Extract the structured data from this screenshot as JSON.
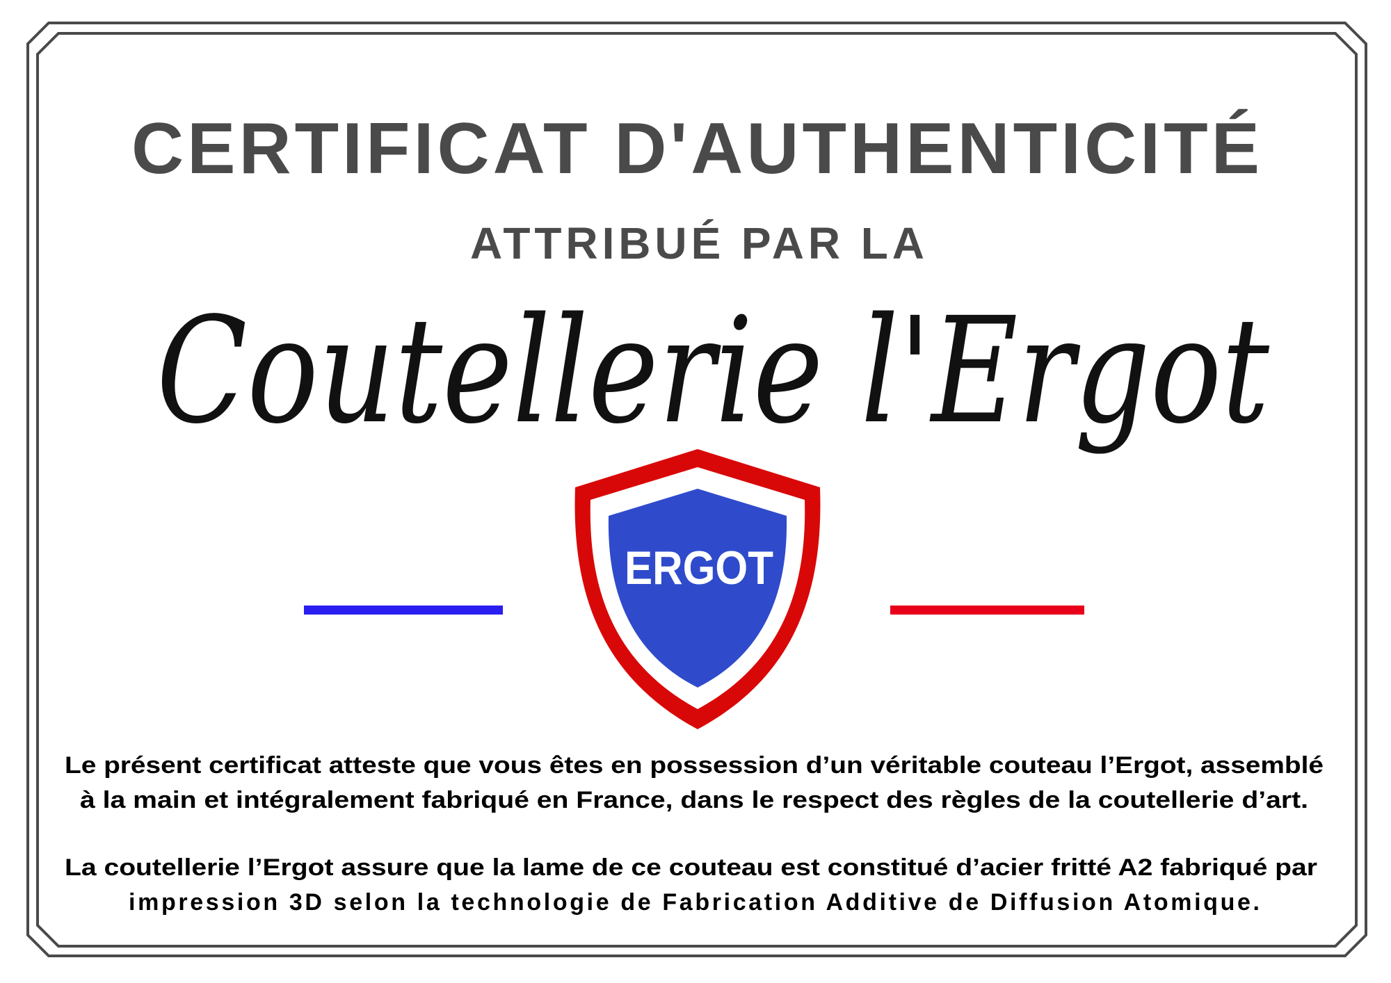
{
  "certificate": {
    "title": "CERTIFICAT D'AUTHENTICITÉ",
    "subtitle": "ATTRIBUÉ PAR LA",
    "brand_script": "Coutellerie l'Ergot",
    "shield_label": "ERGOT",
    "colors": {
      "blue": "#2f4bcc",
      "red": "#d90808",
      "line_blue": "#2a1ef0",
      "line_red": "#e8001a",
      "text_gray": "#4a4a4a"
    },
    "paragraph1_lines": [
      "Le présent certificat atteste que vous êtes en possession d’un véritable couteau l’Ergot, assemblé",
      "à la main et intégralement fabriqué en France, dans le respect des règles de la coutellerie d’art."
    ],
    "paragraph2_lines": [
      "La coutellerie l’Ergot assure que la lame de ce couteau est constitué d’acier fritté A2 fabriqué par",
      "impression 3D selon la technologie de Fabrication Additive de Diffusion Atomique."
    ]
  }
}
